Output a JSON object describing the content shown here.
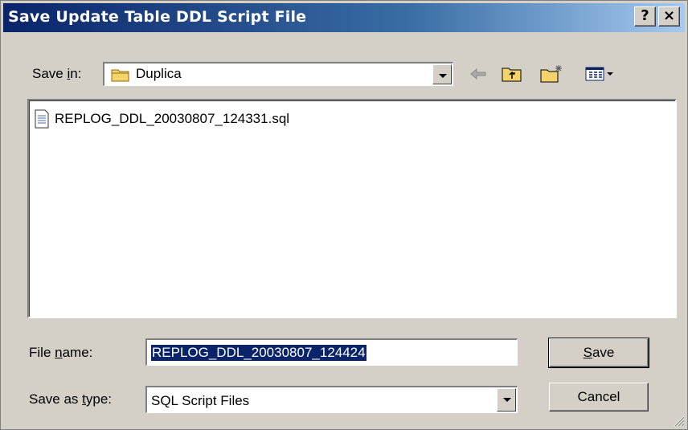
{
  "window": {
    "title": "Save Update Table DDL Script File",
    "help_label": "?",
    "close_label": "×"
  },
  "save_in": {
    "label_pre": "Save ",
    "label_accel": "i",
    "label_post": "n:",
    "value": "Duplica"
  },
  "files": [
    {
      "name": "REPLOG_DDL_20030807_124331.sql",
      "icon": "text-file-icon"
    }
  ],
  "file_name": {
    "label_pre": "File ",
    "label_accel": "n",
    "label_post": "ame:",
    "value": "REPLOG_DDL_20030807_124424"
  },
  "save_as_type": {
    "label_pre": "Save as ",
    "label_accel": "t",
    "label_post": "ype:",
    "value": "SQL Script Files"
  },
  "buttons": {
    "save_accel": "S",
    "save_rest": "ave",
    "cancel": "Cancel"
  },
  "toolbar_icons": [
    "back-arrow-icon",
    "up-folder-icon",
    "new-folder-icon",
    "view-menu-icon"
  ]
}
